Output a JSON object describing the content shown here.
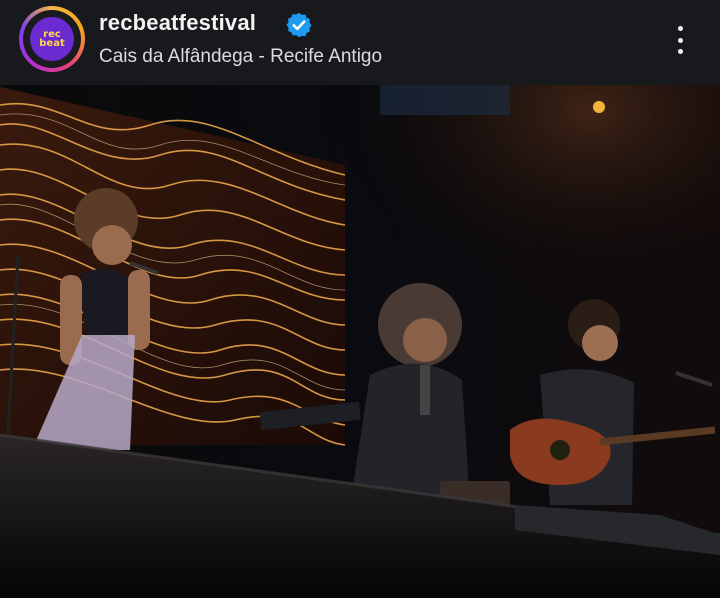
{
  "post": {
    "username": "recbeatfestival",
    "location": "Cais da Alfândega - Recife Antigo",
    "avatar_text_top": "rec",
    "avatar_text_bottom": "beat"
  },
  "colors": {
    "header_bg": "#18191d",
    "verified": "#1d9bf0",
    "stage_gold": "#e9a54a"
  },
  "icons": {
    "verified": "verified-badge-icon",
    "menu": "more-options-icon"
  }
}
